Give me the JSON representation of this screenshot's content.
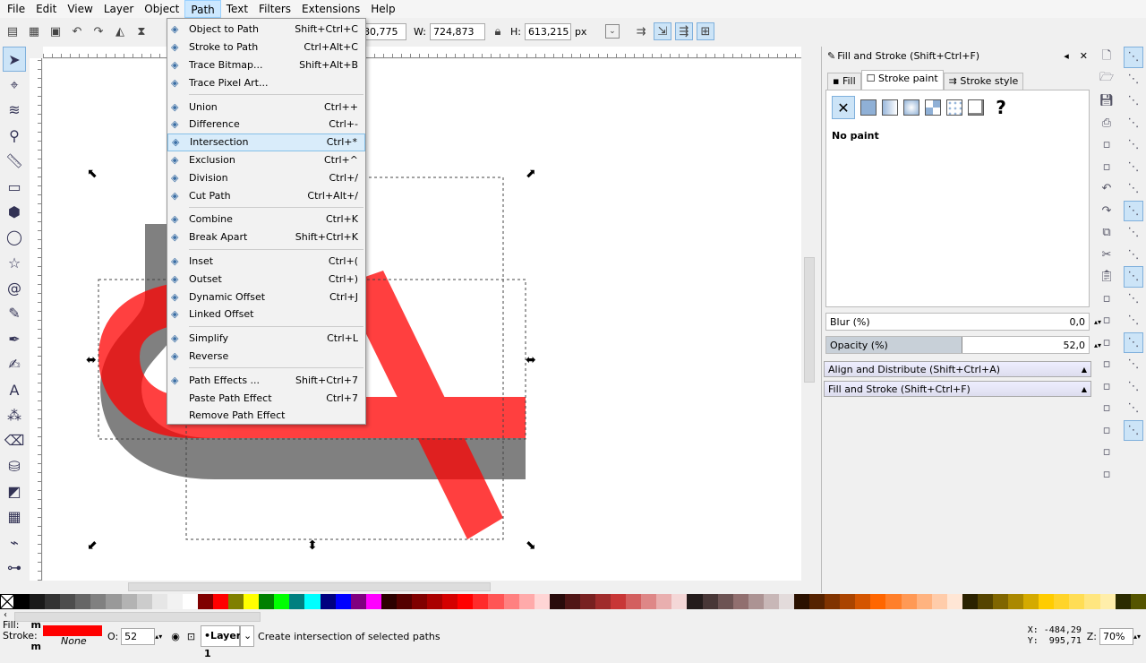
{
  "menubar": [
    "File",
    "Edit",
    "View",
    "Layer",
    "Object",
    "Path",
    "Text",
    "Filters",
    "Extensions",
    "Help"
  ],
  "toolbar": {
    "x_value": "80,775",
    "w_label": "W:",
    "w_value": "724,873",
    "h_label": "H:",
    "h_value": "613,215",
    "unit": "px"
  },
  "tools": [
    "selector-icon",
    "node-icon",
    "tweak-icon",
    "zoom-icon",
    "measure-icon",
    "rectangle-icon",
    "box3d-icon",
    "ellipse-icon",
    "star-icon",
    "spiral-icon",
    "pencil-icon",
    "pen-icon",
    "calligraphy-icon",
    "text-icon",
    "spray-icon",
    "eraser-icon",
    "bucket-icon",
    "gradient-icon",
    "mesh-icon",
    "dropper-icon",
    "connector-icon"
  ],
  "path_menu": [
    {
      "icon": "object-to-path-icon",
      "label": "Object to Path",
      "shortcut": "Shift+Ctrl+C"
    },
    {
      "icon": "stroke-to-path-icon",
      "label": "Stroke to Path",
      "shortcut": "Ctrl+Alt+C"
    },
    {
      "icon": "trace-bitmap-icon",
      "label": "Trace Bitmap...",
      "shortcut": "Shift+Alt+B"
    },
    {
      "icon": "trace-pixel-art-icon",
      "label": "Trace Pixel Art...",
      "shortcut": ""
    },
    {
      "sep": true
    },
    {
      "icon": "union-icon",
      "label": "Union",
      "shortcut": "Ctrl++"
    },
    {
      "icon": "difference-icon",
      "label": "Difference",
      "shortcut": "Ctrl+-"
    },
    {
      "icon": "intersection-icon",
      "label": "Intersection",
      "shortcut": "Ctrl+*",
      "highlighted": true
    },
    {
      "icon": "exclusion-icon",
      "label": "Exclusion",
      "shortcut": "Ctrl+^"
    },
    {
      "icon": "division-icon",
      "label": "Division",
      "shortcut": "Ctrl+/"
    },
    {
      "icon": "cut-path-icon",
      "label": "Cut Path",
      "shortcut": "Ctrl+Alt+/"
    },
    {
      "sep": true
    },
    {
      "icon": "combine-icon",
      "label": "Combine",
      "shortcut": "Ctrl+K"
    },
    {
      "icon": "break-apart-icon",
      "label": "Break Apart",
      "shortcut": "Shift+Ctrl+K"
    },
    {
      "sep": true
    },
    {
      "icon": "inset-icon",
      "label": "Inset",
      "shortcut": "Ctrl+("
    },
    {
      "icon": "outset-icon",
      "label": "Outset",
      "shortcut": "Ctrl+)"
    },
    {
      "icon": "dynamic-offset-icon",
      "label": "Dynamic Offset",
      "shortcut": "Ctrl+J"
    },
    {
      "icon": "linked-offset-icon",
      "label": "Linked Offset",
      "shortcut": ""
    },
    {
      "sep": true
    },
    {
      "icon": "simplify-icon",
      "label": "Simplify",
      "shortcut": "Ctrl+L"
    },
    {
      "icon": "reverse-icon",
      "label": "Reverse",
      "shortcut": ""
    },
    {
      "sep": true
    },
    {
      "icon": "path-effects-icon",
      "label": "Path Effects ...",
      "shortcut": "Shift+Ctrl+7"
    },
    {
      "icon": "",
      "label": "Paste Path Effect",
      "shortcut": "Ctrl+7"
    },
    {
      "icon": "",
      "label": "Remove Path Effect",
      "shortcut": ""
    }
  ],
  "dock": {
    "title": "Fill and Stroke (Shift+Ctrl+F)",
    "tabs": [
      "Fill",
      "Stroke paint",
      "Stroke style"
    ],
    "selected_tab": "Stroke paint",
    "paint_status": "No paint",
    "unknown_paint": "?",
    "blur_label": "Blur (%)",
    "blur_value": "0,0",
    "opacity_label": "Opacity (%)",
    "opacity_value": "52,0",
    "opacity_fraction": 0.52,
    "collapsed": [
      "Align and Distribute (Shift+Ctrl+A)",
      "Fill and Stroke (Shift+Ctrl+F)"
    ]
  },
  "commands": [
    "new-icon",
    "open-icon",
    "save-icon",
    "print-icon",
    "import-icon",
    "export-icon",
    "undo-icon",
    "redo-icon",
    "copy-icon",
    "cut-icon",
    "paste-icon",
    "zoom-selection-icon",
    "zoom-drawing-icon",
    "zoom-page-icon",
    "duplicate-icon",
    "clone-icon",
    "unlink-clone-icon",
    "group-icon",
    "ungroup-icon",
    "preferences-icon"
  ],
  "snaps": [
    "snap-enable-icon",
    "snap-bbox-icon",
    "snap-bbox-edge-icon",
    "snap-bbox-corner-icon",
    "snap-bbox-midpoint-icon",
    "snap-bbox-center-icon",
    "snap-nodes-icon",
    "snap-path-icon",
    "snap-intersection-icon",
    "snap-cusp-icon",
    "snap-smooth-icon",
    "snap-midpoint-icon",
    "snap-center-icon",
    "snap-rotation-icon",
    "snap-text-icon",
    "snap-page-icon",
    "snap-grid-icon",
    "snap-guide-icon"
  ],
  "palette": [
    "#000000",
    "#1a1a1a",
    "#333333",
    "#4d4d4d",
    "#666666",
    "#808080",
    "#999999",
    "#b3b3b3",
    "#cccccc",
    "#e6e6e6",
    "#f2f2f2",
    "#ffffff",
    "#800000",
    "#ff0000",
    "#808000",
    "#ffff00",
    "#008000",
    "#00ff00",
    "#008080",
    "#00ffff",
    "#000080",
    "#0000ff",
    "#800080",
    "#ff00ff",
    "#2b0000",
    "#550000",
    "#800000",
    "#aa0000",
    "#d40000",
    "#ff0000",
    "#ff2a2a",
    "#ff5555",
    "#ff8080",
    "#ffaaaa",
    "#ffd5d5",
    "#280b0b",
    "#501616",
    "#782121",
    "#a02c2c",
    "#c83737",
    "#d35f5f",
    "#de8787",
    "#e9afaf",
    "#f4d7d7",
    "#241c1c",
    "#483737",
    "#6c5353",
    "#916f6f",
    "#ac9393",
    "#c8b7b7",
    "#e3dbdb",
    "#2b1100",
    "#552200",
    "#803300",
    "#aa4400",
    "#d45500",
    "#ff6600",
    "#ff7f2a",
    "#ff9955",
    "#ffb380",
    "#ffccaa",
    "#ffe6d5",
    "#2b2200",
    "#554400",
    "#806600",
    "#aa8800",
    "#d4aa00",
    "#ffcc00",
    "#ffd42a",
    "#ffdd55",
    "#ffe680",
    "#ffeeaa",
    "#2b2b00",
    "#555500"
  ],
  "status": {
    "fill_label": "Fill:",
    "fill_m": "m",
    "stroke_label": "Stroke:",
    "stroke_m": "m",
    "stroke_value": "None",
    "fill_color": "#ff0000",
    "opacity_label": "O:",
    "opacity_value": "52",
    "layer": "•Layer 1",
    "message": "Create intersection of selected paths",
    "x_readout": "X: -484,29",
    "y_readout": "Y:  995,71",
    "zoom_label": "Z:",
    "zoom_value": "70%"
  }
}
